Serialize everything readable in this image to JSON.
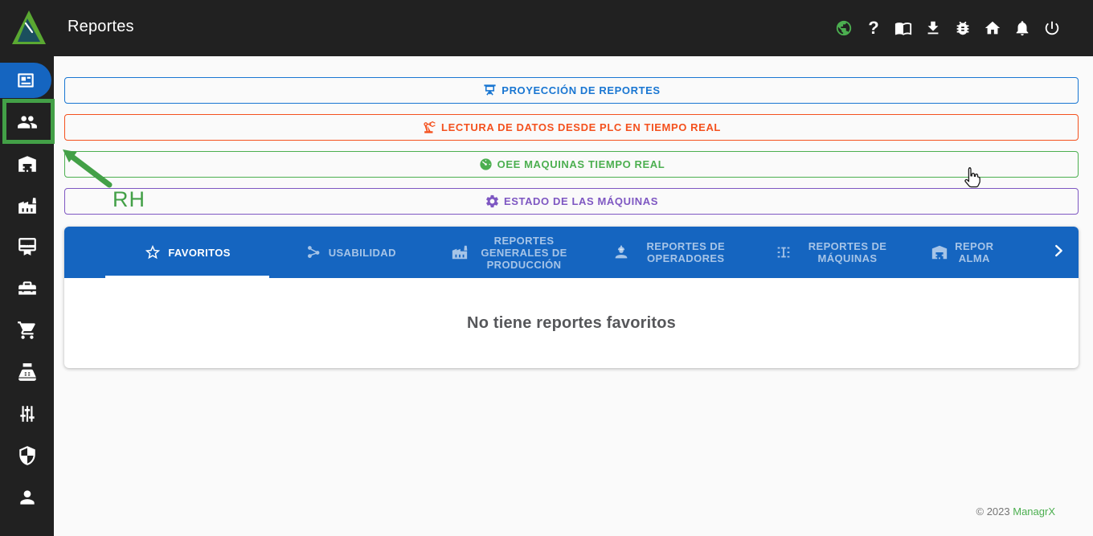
{
  "app": {
    "title": "Reportes",
    "bar_background": "#212121",
    "accent_blue": "#1565c0"
  },
  "header": {
    "title": "Reportes",
    "icons": [
      {
        "name": "globe-icon",
        "color": "#4caf50"
      },
      {
        "name": "help-icon",
        "glyph": "?"
      },
      {
        "name": "manual-book-icon"
      },
      {
        "name": "download-icon"
      },
      {
        "name": "bug-report-icon"
      },
      {
        "name": "home-icon"
      },
      {
        "name": "notifications-icon"
      },
      {
        "name": "power-icon"
      }
    ]
  },
  "sidebar": {
    "items": [
      {
        "icon": "newspaper-reports-icon",
        "active": true
      },
      {
        "icon": "people-icon",
        "highlighted": true
      },
      {
        "icon": "warehouse-icon"
      },
      {
        "icon": "factory-icon"
      },
      {
        "icon": "certificate-icon"
      },
      {
        "icon": "toolbox-icon"
      },
      {
        "icon": "shopping-cart-icon"
      },
      {
        "icon": "cash-register-icon"
      },
      {
        "icon": "sliders-icon"
      },
      {
        "icon": "shield-icon"
      },
      {
        "icon": "person-icon"
      }
    ]
  },
  "annotation": {
    "label": "RH",
    "color": "#43a047"
  },
  "banners": [
    {
      "label": "PROYECCIÓN DE REPORTES",
      "icon": "projector-screen-icon",
      "color": "#1976d2"
    },
    {
      "label": "LECTURA DE DATOS DESDE PLC EN TIEMPO REAL",
      "icon": "robot-arm-icon",
      "color": "#f4511e"
    },
    {
      "label": "OEE MAQUINAS TIEMPO REAL",
      "icon": "gauge-icon",
      "color": "#4caf50"
    },
    {
      "label": "ESTADO DE LAS MÁQUINAS",
      "icon": "gear-icon",
      "color": "#7e57c2"
    }
  ],
  "tabs": {
    "bar_color": "#1565c0",
    "items": [
      {
        "label": "FAVORITOS",
        "icon": "star-icon",
        "active": true
      },
      {
        "label": "USABILIDAD",
        "icon": "hub-icon"
      },
      {
        "label": "REPORTES GENERALES DE PRODUCCIÓN",
        "icon": "factory-icon"
      },
      {
        "label": "REPORTES DE OPERADORES",
        "icon": "operator-icon"
      },
      {
        "label": "REPORTES DE MÁQUINAS",
        "icon": "machine-icon"
      },
      {
        "label_line1": "REPOR",
        "label_line2": "ALMA",
        "icon": "warehouse-icon",
        "clipped": true
      }
    ],
    "scroll_right_icon": "chevron-right-icon"
  },
  "content": {
    "empty_message": "No tiene reportes favoritos"
  },
  "footer": {
    "copyright": "© 2023",
    "brand": "ManagrX",
    "brand_color": "#4caf50"
  }
}
